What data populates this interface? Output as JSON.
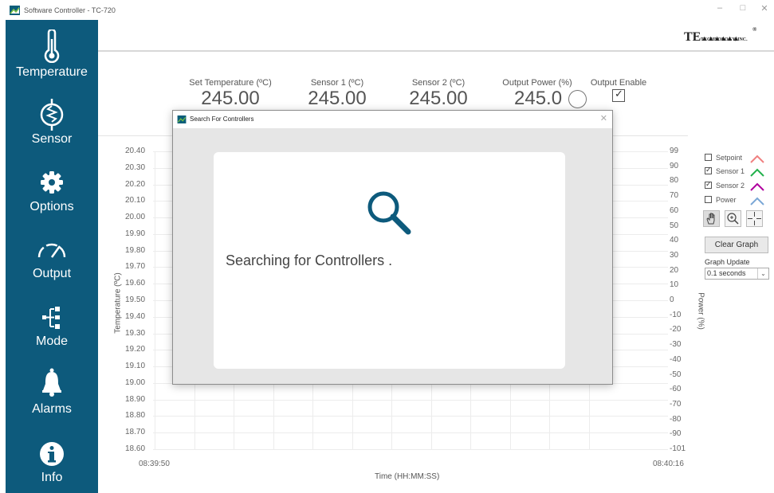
{
  "window": {
    "title": "Software Controller - TC-720",
    "minimize": "–",
    "maximize": "□",
    "close": "✕"
  },
  "sidebar": {
    "items": [
      {
        "label": "Temperature",
        "icon": "thermometer-icon"
      },
      {
        "label": "Sensor",
        "icon": "sensor-coil-icon"
      },
      {
        "label": "Options",
        "icon": "gear-icon"
      },
      {
        "label": "Output",
        "icon": "gauge-icon"
      },
      {
        "label": "Mode",
        "icon": "mode-tree-icon"
      },
      {
        "label": "Alarms",
        "icon": "bell-icon"
      },
      {
        "label": "Info",
        "icon": "info-icon"
      }
    ]
  },
  "logo": {
    "main": "TE",
    "sub": "TECHNOLOGY, INC.",
    "reg": "®"
  },
  "readouts": [
    {
      "caption": "Set Temperature (ºC)",
      "value": "245.00"
    },
    {
      "caption": "Sensor 1 (ºC)",
      "value": "245.00"
    },
    {
      "caption": "Sensor 2 (ºC)",
      "value": "245.00"
    },
    {
      "caption": "Output Power (%)",
      "value": "245.0"
    }
  ],
  "output_enable": {
    "label": "Output Enable",
    "checked": true
  },
  "chart": {
    "y_left_ticks": [
      "20.40",
      "20.30",
      "20.20",
      "20.10",
      "20.00",
      "19.90",
      "19.80",
      "19.70",
      "19.60",
      "19.50",
      "19.40",
      "19.30",
      "19.20",
      "19.10",
      "19.00",
      "18.90",
      "18.80",
      "18.70",
      "18.60"
    ],
    "y_right_ticks": [
      "99",
      "90",
      "80",
      "70",
      "60",
      "50",
      "40",
      "30",
      "20",
      "10",
      "0",
      "-10",
      "-20",
      "-30",
      "-40",
      "-50",
      "-60",
      "-70",
      "-80",
      "-90",
      "-101"
    ],
    "x_start": "08:39:50",
    "x_end": "08:40:16",
    "y_left_label": "Temperature (ºC)",
    "y_right_label": "Power (%)",
    "x_label": "Time (HH:MM:SS)"
  },
  "legend": [
    {
      "label": "Setpoint",
      "checked": false,
      "color": "#f08080"
    },
    {
      "label": "Sensor 1",
      "checked": true,
      "color": "#22b14c"
    },
    {
      "label": "Sensor 2",
      "checked": true,
      "color": "#b0009e"
    },
    {
      "label": "Power",
      "checked": false,
      "color": "#7aa7d6"
    }
  ],
  "tools": {
    "pan": "hand-icon",
    "zoom": "zoom-in-icon",
    "crosshair": "crosshair-icon"
  },
  "clear_graph": "Clear Graph",
  "graph_update": {
    "label": "Graph Update",
    "value": "0.1 seconds"
  },
  "dialog": {
    "title": "Search For Controllers",
    "close": "✕",
    "message": "Searching for Controllers ."
  },
  "colors": {
    "sidebar": "#0d5a7c",
    "search_icon": "#0d5a7c"
  }
}
